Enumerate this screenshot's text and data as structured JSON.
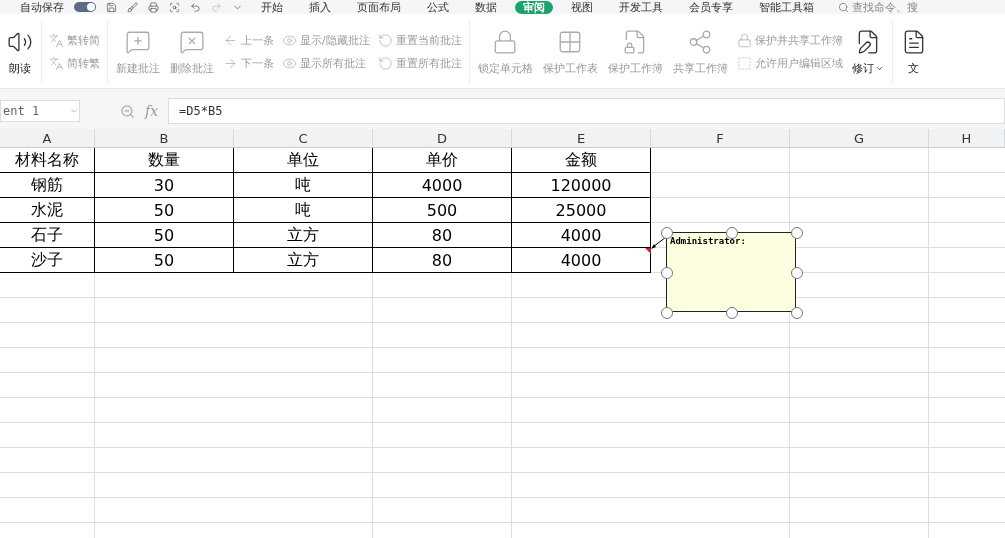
{
  "quick_bar": {
    "autosave_label": "自动保存",
    "autosave_on": true
  },
  "menu_tabs": [
    {
      "label": "开始",
      "selected": false
    },
    {
      "label": "插入",
      "selected": false
    },
    {
      "label": "页面布局",
      "selected": false
    },
    {
      "label": "公式",
      "selected": false
    },
    {
      "label": "数据",
      "selected": false
    },
    {
      "label": "审阅",
      "selected": true
    },
    {
      "label": "视图",
      "selected": false
    },
    {
      "label": "开发工具",
      "selected": false
    },
    {
      "label": "会员专享",
      "selected": false
    },
    {
      "label": "智能工具箱",
      "selected": false
    }
  ],
  "search": {
    "placeholder": "查找命令、搜"
  },
  "ribbon": [
    {
      "kind": "large",
      "label": "朗读",
      "disabled": false
    },
    {
      "kind": "stack",
      "items": [
        {
          "label": "繁转简",
          "disabled": true
        },
        {
          "label": "简转繁",
          "disabled": true
        }
      ]
    },
    {
      "kind": "large",
      "label": "新建批注",
      "disabled": true
    },
    {
      "kind": "large",
      "label": "删除批注",
      "disabled": true
    },
    {
      "kind": "stack",
      "items": [
        {
          "label": "上一条",
          "disabled": true
        },
        {
          "label": "下一条",
          "disabled": true
        }
      ]
    },
    {
      "kind": "stack",
      "items": [
        {
          "label": "显示/隐藏批注",
          "disabled": true
        },
        {
          "label": "显示所有批注",
          "disabled": true
        }
      ]
    },
    {
      "kind": "stack",
      "items": [
        {
          "label": "重置当前批注",
          "disabled": true
        },
        {
          "label": "重置所有批注",
          "disabled": true
        }
      ]
    },
    {
      "kind": "large",
      "label": "锁定单元格",
      "disabled": true
    },
    {
      "kind": "large",
      "label": "保护工作表",
      "disabled": true
    },
    {
      "kind": "large",
      "label": "保护工作簿",
      "disabled": true
    },
    {
      "kind": "large",
      "label": "共享工作簿",
      "disabled": true
    },
    {
      "kind": "stack",
      "items": [
        {
          "label": "保护并共享工作簿",
          "disabled": true
        },
        {
          "label": "允许用户编辑区域",
          "disabled": true
        }
      ]
    },
    {
      "kind": "large",
      "label": "修订",
      "disabled": false,
      "dropdown": true
    },
    {
      "kind": "large",
      "label": "文",
      "disabled": false
    }
  ],
  "name_box": "ent 1",
  "fx_label": "fx",
  "formula": "=D5*B5",
  "columns": [
    "A",
    "B",
    "C",
    "D",
    "E",
    "F",
    "G",
    "H"
  ],
  "rows": [
    [
      "材料名称",
      "数量",
      "单位",
      "单价",
      "金额"
    ],
    [
      "钢筋",
      "30",
      "吨",
      "4000",
      "120000"
    ],
    [
      "水泥",
      "50",
      "吨",
      "500",
      "25000"
    ],
    [
      "石子",
      "50",
      "立方",
      "80",
      "4000"
    ],
    [
      "沙子",
      "50",
      "立方",
      "80",
      "4000"
    ]
  ],
  "comment": {
    "author": "Administrator:"
  }
}
